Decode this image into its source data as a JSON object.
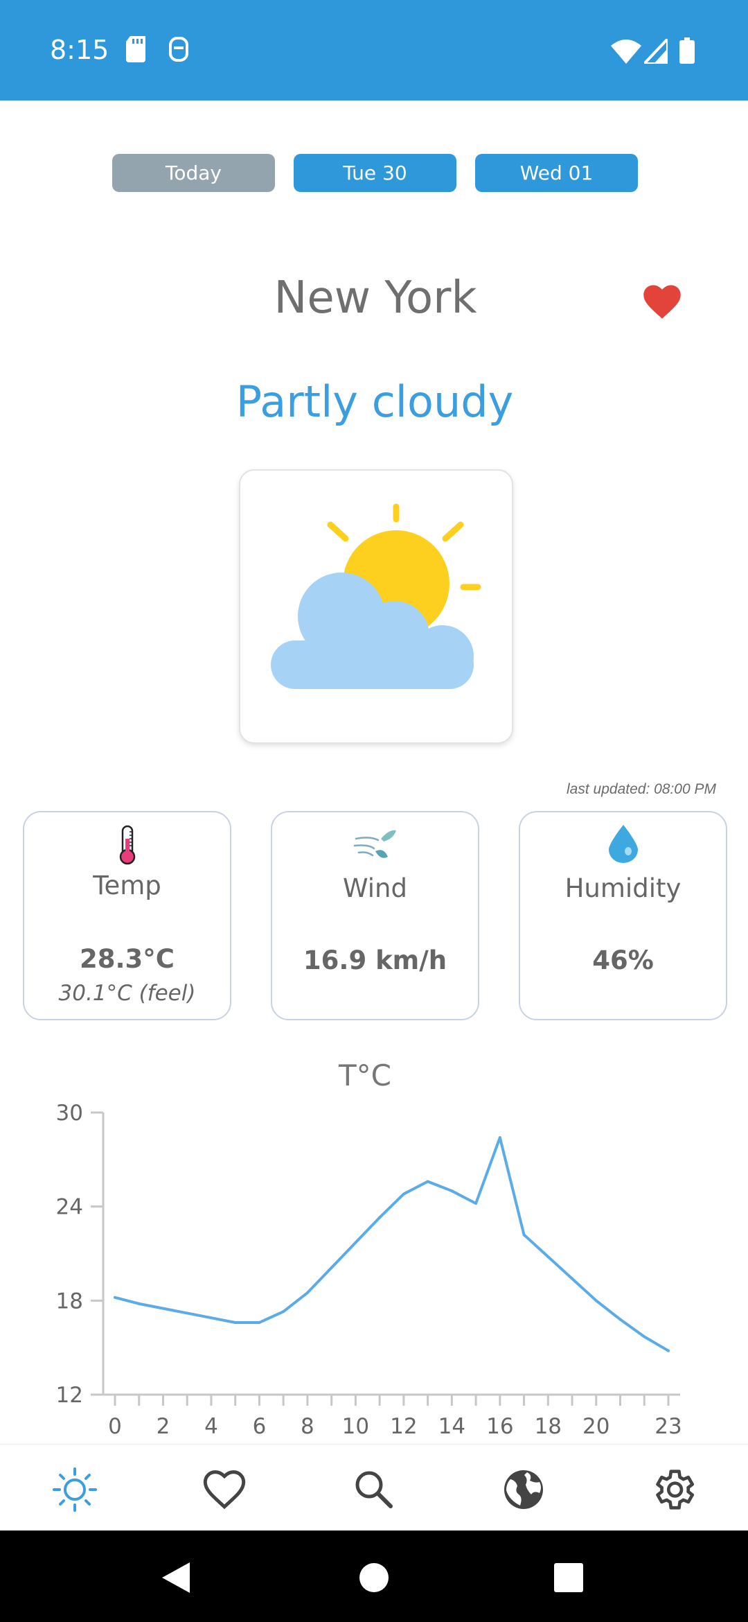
{
  "status_bar": {
    "time": "8:15",
    "icons": [
      "sd-card-icon",
      "notification-icon",
      "wifi-icon",
      "signal-icon",
      "battery-icon"
    ]
  },
  "day_tabs": [
    {
      "label": "Today",
      "selected": true
    },
    {
      "label": "Tue 30",
      "selected": false
    },
    {
      "label": "Wed 01",
      "selected": false
    }
  ],
  "location": {
    "city": "New York",
    "favorite": true
  },
  "condition": "Partly cloudy",
  "weather_icon": "partly-cloudy-icon",
  "last_updated": "last updated: 08:00 PM",
  "stats": {
    "temp": {
      "label": "Temp",
      "value": "28.3°C",
      "feel": "30.1°C  (feel)",
      "icon": "thermometer-icon"
    },
    "wind": {
      "label": "Wind",
      "value": "16.9 km/h",
      "icon": "wind-icon"
    },
    "humidity": {
      "label": "Humidity",
      "value": "46%",
      "icon": "water-drop-icon"
    }
  },
  "chart_data": {
    "type": "line",
    "title": "T°C",
    "xlabel": "",
    "ylabel": "",
    "x": [
      0,
      1,
      2,
      3,
      4,
      5,
      6,
      7,
      8,
      9,
      10,
      11,
      12,
      13,
      14,
      15,
      16,
      17,
      18,
      19,
      20,
      21,
      22,
      23
    ],
    "values": [
      18.2,
      17.8,
      17.5,
      17.2,
      16.9,
      16.6,
      16.6,
      17.3,
      18.5,
      20.1,
      21.7,
      23.3,
      24.8,
      25.6,
      25.0,
      24.2,
      28.4,
      22.2,
      20.8,
      19.4,
      18.0,
      16.8,
      15.7,
      14.8
    ],
    "xticks": [
      "0",
      "2",
      "4",
      "6",
      "8",
      "10",
      "12",
      "14",
      "16",
      "18",
      "20",
      "23"
    ],
    "yticks": [
      "12",
      "18",
      "24",
      "30"
    ],
    "ylim": [
      12,
      30
    ],
    "xlim": [
      0,
      23
    ],
    "line_color": "#5aabe8"
  },
  "bottom_nav": [
    {
      "name": "today",
      "icon": "sun-icon",
      "active": true
    },
    {
      "name": "favorites",
      "icon": "heart-icon",
      "active": false
    },
    {
      "name": "search",
      "icon": "search-icon",
      "active": false
    },
    {
      "name": "world",
      "icon": "globe-icon",
      "active": false
    },
    {
      "name": "settings",
      "icon": "gear-icon",
      "active": false
    }
  ],
  "colors": {
    "primary": "#2f98db",
    "tab_selected": "#93a4ae",
    "accent_text": "#3b9fdf",
    "heart": "#e2433a",
    "sun": "#fdd020",
    "cloud": "#a6d3f5",
    "card_border": "#c8d2e2"
  }
}
